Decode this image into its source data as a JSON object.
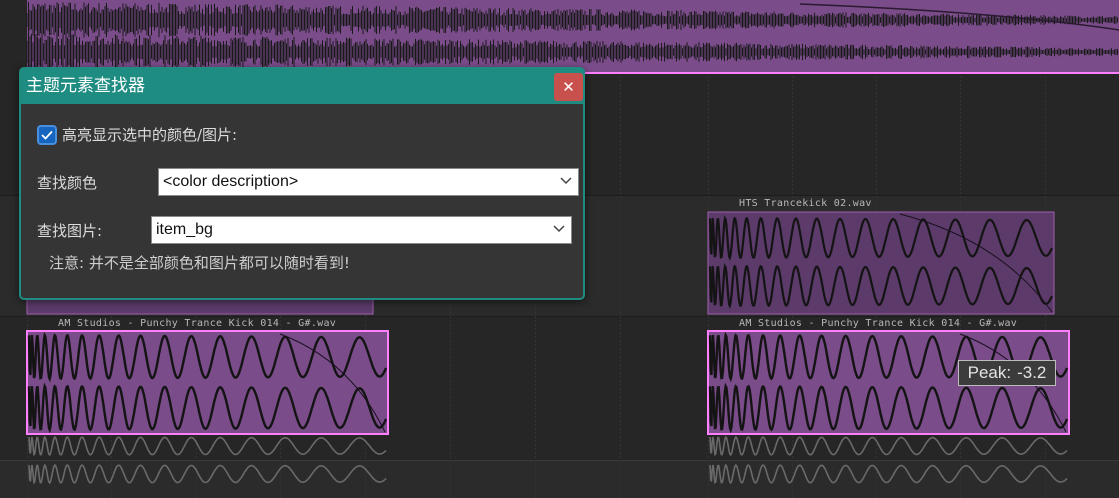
{
  "arrange": {
    "clips": [
      {
        "label": "HTS Trancekick 02.wav"
      },
      {
        "label": "AM Studios - Punchy Trance Kick 014 - G#.wav"
      },
      {
        "label": "AM Studios - Punchy Trance Kick 014 - G#.wav"
      }
    ],
    "peak_tooltip": {
      "label": "Peak:",
      "value": "-3.2"
    }
  },
  "dialog": {
    "title": "主题元素查找器",
    "close_icon": "close-icon",
    "highlight_checkbox": {
      "label": "高亮显示选中的颜色/图片:",
      "checked": true
    },
    "find_color": {
      "label": "查找颜色",
      "value": "<color description>"
    },
    "find_image": {
      "label": "查找图片:",
      "value": "item_bg"
    },
    "note": "注意: 并不是全部颜色和图片都可以随时看到!"
  },
  "colors": {
    "accent": "#1f8c82",
    "close": "#c8504d",
    "clip_fill": "#7a4c8a",
    "clip_border": "#ff80ff",
    "background": "#262626"
  }
}
